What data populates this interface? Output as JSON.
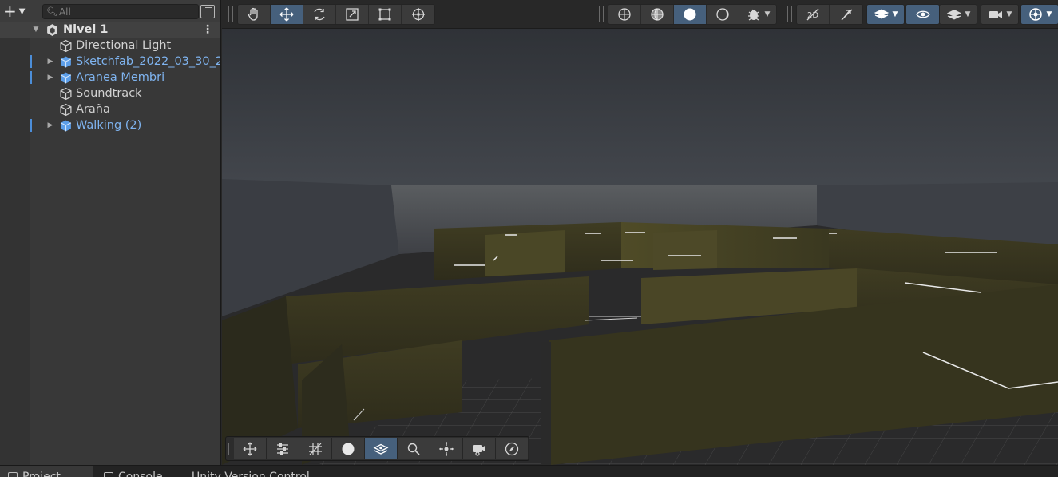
{
  "hierarchy": {
    "search_placeholder": "All",
    "add_label": "+",
    "scene_name": "Nivel 1",
    "items": [
      {
        "label": "Directional Light",
        "type": "object",
        "expandable": false
      },
      {
        "label": "Sketchfab_2022_03_30_2",
        "type": "prefab",
        "expandable": true
      },
      {
        "label": "Aranea Membri",
        "type": "prefab",
        "expandable": true
      },
      {
        "label": "Soundtrack",
        "type": "object",
        "expandable": false
      },
      {
        "label": "Araña",
        "type": "object",
        "expandable": false
      },
      {
        "label": "Walking (2)",
        "type": "prefab",
        "expandable": true
      }
    ]
  },
  "scene_toolbar": {
    "tools": [
      {
        "name": "hand-tool",
        "icon": "hand-icon",
        "active": false
      },
      {
        "name": "move-tool",
        "icon": "move-icon",
        "active": true
      },
      {
        "name": "rotate-tool",
        "icon": "rotate-icon",
        "active": false
      },
      {
        "name": "scale-tool",
        "icon": "scale-icon",
        "active": false
      },
      {
        "name": "rect-tool",
        "icon": "rect-icon",
        "active": false
      },
      {
        "name": "transform-tool",
        "icon": "transform-icon",
        "active": false
      }
    ],
    "shading": [
      {
        "name": "wireframe-shading",
        "icon": "wireframe-globe-icon",
        "active": false
      },
      {
        "name": "shaded-wireframe",
        "icon": "shaded-wireframe-globe-icon",
        "active": false
      },
      {
        "name": "shaded",
        "icon": "shaded-sphere-icon",
        "active": true
      },
      {
        "name": "unlit",
        "icon": "unlit-sphere-icon",
        "active": false
      }
    ]
  },
  "colors": {
    "accent_active": "#46607c",
    "prefab_text": "#7fb4f0",
    "panel_bg": "#383838",
    "toolbar_bg": "#282828",
    "wall_color": "#3d3a22"
  },
  "bottom_tabs": [
    {
      "label": "Project",
      "active": true
    },
    {
      "label": "Console",
      "active": false
    },
    {
      "label": "Unity Version Control",
      "active": false
    }
  ]
}
